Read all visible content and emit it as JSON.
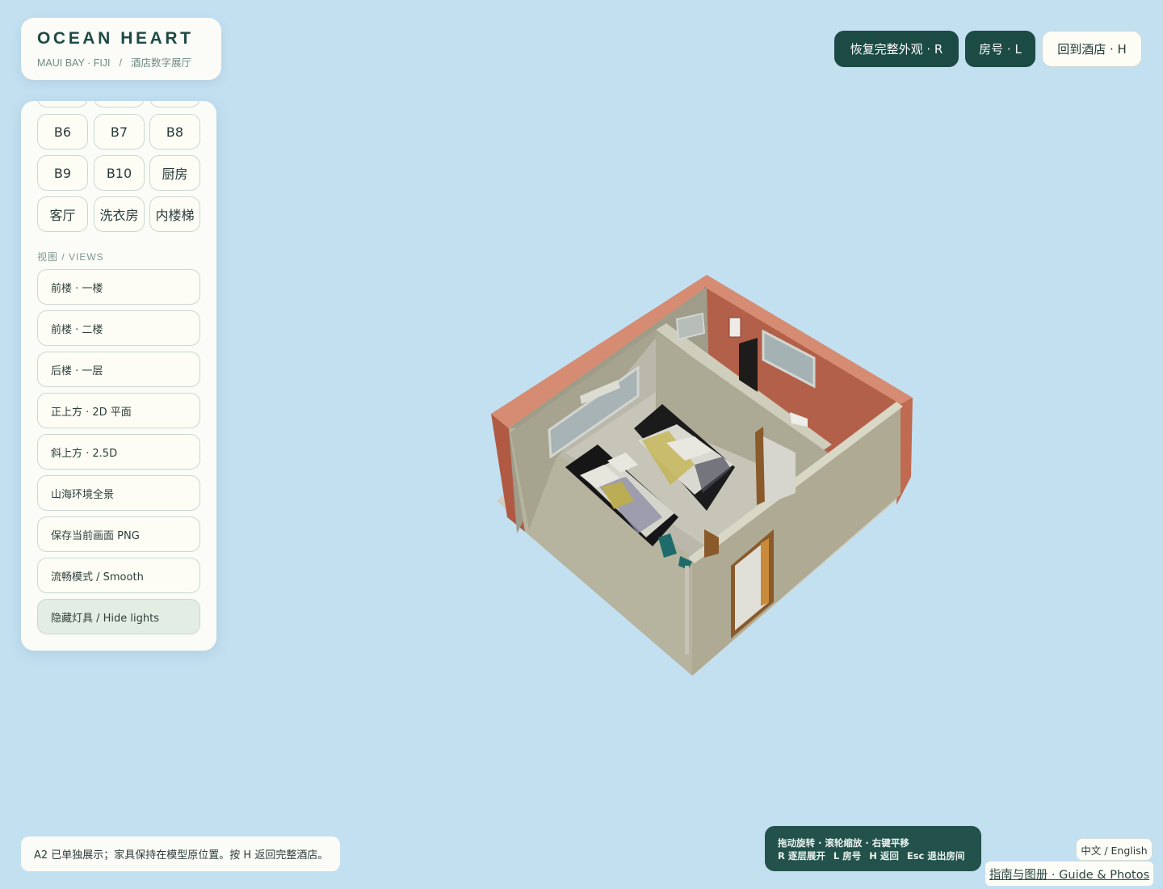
{
  "brand": {
    "title": "OCEAN HEART",
    "location": "MAUI BAY · FIJI",
    "separator": "/",
    "subtitle": "酒店数字展厅"
  },
  "rooms": [
    "B6",
    "B7",
    "B8",
    "B9",
    "B10",
    "厨房",
    "客厅",
    "洗衣房",
    "内楼梯"
  ],
  "views_label": "视图 / VIEWS",
  "views": [
    "前楼 · 一楼",
    "前楼 · 二楼",
    "后楼 · 一层",
    "正上方 · 2D 平面",
    "斜上方 · 2.5D",
    "山海环境全景",
    "保存当前画面 PNG",
    "流畅模式 / Smooth",
    "隐藏灯具 / Hide lights"
  ],
  "top_buttons": {
    "restore": "恢复完整外观 · R",
    "room_number": "房号 · L",
    "back_hotel": "回到酒店 · H"
  },
  "status_text": "A2 已单独展示；家具保持在模型原位置。按 H 返回完整酒店。",
  "hints": {
    "line1": "拖动旋转 · 滚轮缩放 · 右键平移",
    "k1": "R 逐层展开",
    "k2": "L 房号",
    "k3": "H 返回",
    "k4": "Esc 退出房间"
  },
  "language_toggle": "中文 / English",
  "guide_link": "指南与图册 · Guide & Photos",
  "colors": {
    "background": "#c3e0f1",
    "accent_dark": "#1c4a44",
    "hint_bg": "#23524c",
    "brick_wall": "#b36049",
    "interior_wall": "#b1ad98"
  }
}
